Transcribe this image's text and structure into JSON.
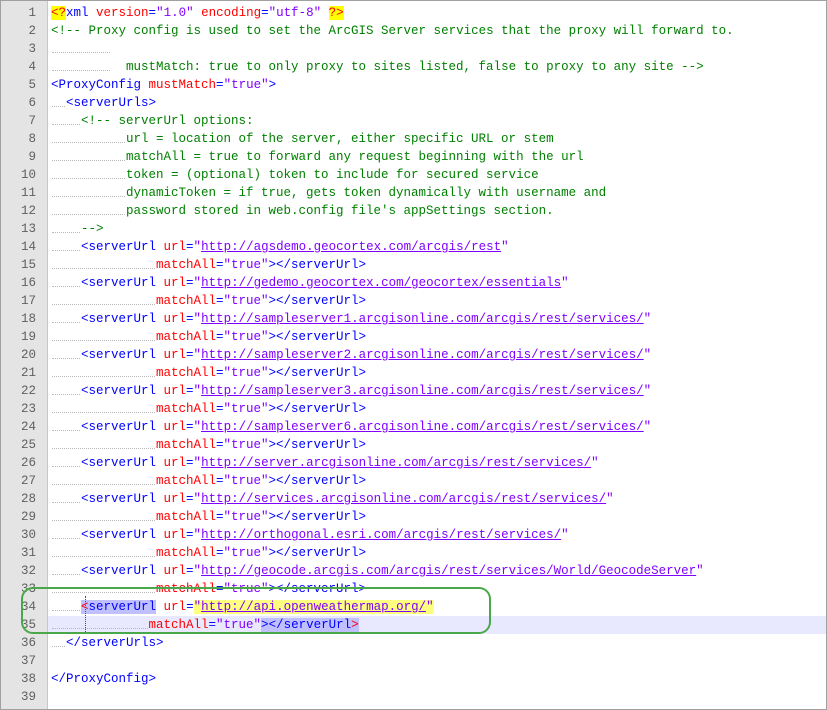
{
  "editor": {
    "lines": [
      {
        "n": "1",
        "ind": 0,
        "tokens": [
          [
            "decl",
            "<?"
          ],
          [
            "tag",
            "xml "
          ],
          [
            "attr",
            "version"
          ],
          [
            "tag",
            "="
          ],
          [
            "val",
            "\"1.0\""
          ],
          [
            "tag",
            " "
          ],
          [
            "attr",
            "encoding"
          ],
          [
            "tag",
            "="
          ],
          [
            "val",
            "\"utf-8\""
          ],
          [
            "tag",
            " "
          ],
          [
            "decl",
            "?>"
          ]
        ]
      },
      {
        "n": "2",
        "ind": 0,
        "tokens": [
          [
            "comment",
            "<!-- Proxy config is used to set the ArcGIS Server services that the proxy will forward to."
          ]
        ]
      },
      {
        "n": "3",
        "ind": 8,
        "tokens": []
      },
      {
        "n": "4",
        "ind": 8,
        "tokens": [
          [
            "comment",
            "  mustMatch: true to only proxy to sites listed, false to proxy to any site -->"
          ]
        ]
      },
      {
        "n": "5",
        "ind": 0,
        "tokens": [
          [
            "tag",
            "<ProxyConfig "
          ],
          [
            "attr",
            "mustMatch"
          ],
          [
            "tag",
            "="
          ],
          [
            "val",
            "\"true\""
          ],
          [
            "tag",
            ">"
          ]
        ]
      },
      {
        "n": "6",
        "ind": 2,
        "tokens": [
          [
            "tag",
            "<serverUrls>"
          ]
        ]
      },
      {
        "n": "7",
        "ind": 4,
        "tokens": [
          [
            "comment",
            "<!-- serverUrl options:"
          ]
        ]
      },
      {
        "n": "8",
        "ind": 10,
        "tokens": [
          [
            "comment",
            "url = location of the server, either specific URL or stem"
          ]
        ]
      },
      {
        "n": "9",
        "ind": 10,
        "tokens": [
          [
            "comment",
            "matchAll = true to forward any request beginning with the url"
          ]
        ]
      },
      {
        "n": "10",
        "ind": 10,
        "tokens": [
          [
            "comment",
            "token = (optional) token to include for secured service"
          ]
        ]
      },
      {
        "n": "11",
        "ind": 10,
        "tokens": [
          [
            "comment",
            "dynamicToken = if true, gets token dynamically with username and"
          ]
        ]
      },
      {
        "n": "12",
        "ind": 10,
        "tokens": [
          [
            "comment",
            "password stored in web.config file's appSettings section."
          ]
        ]
      },
      {
        "n": "13",
        "ind": 4,
        "tokens": [
          [
            "comment",
            "-->"
          ]
        ]
      },
      {
        "n": "14",
        "ind": 4,
        "tokens": [
          [
            "tag",
            "<serverUrl "
          ],
          [
            "attr",
            "url"
          ],
          [
            "tag",
            "="
          ],
          [
            "val",
            "\""
          ],
          [
            "url",
            "http://agsdemo.geocortex.com/arcgis/rest"
          ],
          [
            "val",
            "\""
          ]
        ]
      },
      {
        "n": "15",
        "ind": 14,
        "tokens": [
          [
            "attr",
            "matchAll"
          ],
          [
            "tag",
            "="
          ],
          [
            "val",
            "\"true\""
          ],
          [
            "tag",
            "></serverUrl>"
          ]
        ]
      },
      {
        "n": "16",
        "ind": 4,
        "tokens": [
          [
            "tag",
            "<serverUrl "
          ],
          [
            "attr",
            "url"
          ],
          [
            "tag",
            "="
          ],
          [
            "val",
            "\""
          ],
          [
            "url",
            "http://gedemo.geocortex.com/geocortex/essentials"
          ],
          [
            "val",
            "\""
          ]
        ]
      },
      {
        "n": "17",
        "ind": 14,
        "tokens": [
          [
            "attr",
            "matchAll"
          ],
          [
            "tag",
            "="
          ],
          [
            "val",
            "\"true\""
          ],
          [
            "tag",
            "></serverUrl>"
          ]
        ]
      },
      {
        "n": "18",
        "ind": 4,
        "tokens": [
          [
            "tag",
            "<serverUrl "
          ],
          [
            "attr",
            "url"
          ],
          [
            "tag",
            "="
          ],
          [
            "val",
            "\""
          ],
          [
            "url",
            "http://sampleserver1.arcgisonline.com/arcgis/rest/services/"
          ],
          [
            "val",
            "\""
          ]
        ]
      },
      {
        "n": "19",
        "ind": 14,
        "tokens": [
          [
            "attr",
            "matchAll"
          ],
          [
            "tag",
            "="
          ],
          [
            "val",
            "\"true\""
          ],
          [
            "tag",
            "></serverUrl>"
          ]
        ]
      },
      {
        "n": "20",
        "ind": 4,
        "tokens": [
          [
            "tag",
            "<serverUrl "
          ],
          [
            "attr",
            "url"
          ],
          [
            "tag",
            "="
          ],
          [
            "val",
            "\""
          ],
          [
            "url",
            "http://sampleserver2.arcgisonline.com/arcgis/rest/services/"
          ],
          [
            "val",
            "\""
          ]
        ]
      },
      {
        "n": "21",
        "ind": 14,
        "tokens": [
          [
            "attr",
            "matchAll"
          ],
          [
            "tag",
            "="
          ],
          [
            "val",
            "\"true\""
          ],
          [
            "tag",
            "></serverUrl>"
          ]
        ]
      },
      {
        "n": "22",
        "ind": 4,
        "tokens": [
          [
            "tag",
            "<serverUrl "
          ],
          [
            "attr",
            "url"
          ],
          [
            "tag",
            "="
          ],
          [
            "val",
            "\""
          ],
          [
            "url",
            "http://sampleserver3.arcgisonline.com/arcgis/rest/services/"
          ],
          [
            "val",
            "\""
          ]
        ]
      },
      {
        "n": "23",
        "ind": 14,
        "tokens": [
          [
            "attr",
            "matchAll"
          ],
          [
            "tag",
            "="
          ],
          [
            "val",
            "\"true\""
          ],
          [
            "tag",
            "></serverUrl>"
          ]
        ]
      },
      {
        "n": "24",
        "ind": 4,
        "tokens": [
          [
            "tag",
            "<serverUrl "
          ],
          [
            "attr",
            "url"
          ],
          [
            "tag",
            "="
          ],
          [
            "val",
            "\""
          ],
          [
            "url",
            "http://sampleserver6.arcgisonline.com/arcgis/rest/services/"
          ],
          [
            "val",
            "\""
          ]
        ]
      },
      {
        "n": "25",
        "ind": 14,
        "tokens": [
          [
            "attr",
            "matchAll"
          ],
          [
            "tag",
            "="
          ],
          [
            "val",
            "\"true\""
          ],
          [
            "tag",
            "></serverUrl>"
          ]
        ]
      },
      {
        "n": "26",
        "ind": 4,
        "tokens": [
          [
            "tag",
            "<serverUrl "
          ],
          [
            "attr",
            "url"
          ],
          [
            "tag",
            "="
          ],
          [
            "val",
            "\""
          ],
          [
            "url",
            "http://server.arcgisonline.com/arcgis/rest/services/"
          ],
          [
            "val",
            "\""
          ]
        ]
      },
      {
        "n": "27",
        "ind": 14,
        "tokens": [
          [
            "attr",
            "matchAll"
          ],
          [
            "tag",
            "="
          ],
          [
            "val",
            "\"true\""
          ],
          [
            "tag",
            "></serverUrl>"
          ]
        ]
      },
      {
        "n": "28",
        "ind": 4,
        "tokens": [
          [
            "tag",
            "<serverUrl "
          ],
          [
            "attr",
            "url"
          ],
          [
            "tag",
            "="
          ],
          [
            "val",
            "\""
          ],
          [
            "url",
            "http://services.arcgisonline.com/arcgis/rest/services/"
          ],
          [
            "val",
            "\""
          ]
        ]
      },
      {
        "n": "29",
        "ind": 14,
        "tokens": [
          [
            "attr",
            "matchAll"
          ],
          [
            "tag",
            "="
          ],
          [
            "val",
            "\"true\""
          ],
          [
            "tag",
            "></serverUrl>"
          ]
        ]
      },
      {
        "n": "30",
        "ind": 4,
        "tokens": [
          [
            "tag",
            "<serverUrl "
          ],
          [
            "attr",
            "url"
          ],
          [
            "tag",
            "="
          ],
          [
            "val",
            "\""
          ],
          [
            "url",
            "http://orthogonal.esri.com/arcgis/rest/services/"
          ],
          [
            "val",
            "\""
          ]
        ]
      },
      {
        "n": "31",
        "ind": 14,
        "tokens": [
          [
            "attr",
            "matchAll"
          ],
          [
            "tag",
            "="
          ],
          [
            "val",
            "\"true\""
          ],
          [
            "tag",
            "></serverUrl>"
          ]
        ]
      },
      {
        "n": "32",
        "ind": 4,
        "tokens": [
          [
            "tag",
            "<serverUrl "
          ],
          [
            "attr",
            "url"
          ],
          [
            "tag",
            "="
          ],
          [
            "val",
            "\""
          ],
          [
            "url",
            "http://geocode.arcgis.com/arcgis/rest/services/World/GeocodeServer"
          ],
          [
            "val",
            "\""
          ]
        ]
      },
      {
        "n": "33",
        "ind": 14,
        "tokens": [
          [
            "attr",
            "matchAll"
          ],
          [
            "tag",
            "="
          ],
          [
            "val",
            "\"true\""
          ],
          [
            "tag",
            "></serverUrl>"
          ]
        ]
      },
      {
        "n": "34",
        "ind": 4,
        "tokens": [
          [
            "tag-hl-red",
            "<"
          ],
          [
            "tag-hl",
            "serverUrl"
          ],
          [
            "tag",
            " "
          ],
          [
            "attr",
            "url"
          ],
          [
            "tag",
            "="
          ],
          [
            "val-y",
            "\""
          ],
          [
            "url-y",
            "http://api.openweathermap.org/"
          ],
          [
            "val-y",
            "\""
          ]
        ]
      },
      {
        "n": "35",
        "ind": 13,
        "active": true,
        "tokens": [
          [
            "attr",
            "matchAll"
          ],
          [
            "tag",
            "="
          ],
          [
            "val",
            "\"true\""
          ],
          [
            "tag-hl",
            ">"
          ],
          [
            "tag-hl",
            "</serverUrl"
          ],
          [
            "tag-hl-red",
            ">"
          ]
        ]
      },
      {
        "n": "36",
        "ind": 2,
        "tokens": [
          [
            "tag",
            "</serverUrls>"
          ]
        ]
      },
      {
        "n": "37",
        "ind": 0,
        "tokens": []
      },
      {
        "n": "38",
        "ind": 0,
        "tokens": [
          [
            "tag",
            "</ProxyConfig>"
          ]
        ]
      },
      {
        "n": "39",
        "ind": 0,
        "tokens": []
      }
    ]
  }
}
